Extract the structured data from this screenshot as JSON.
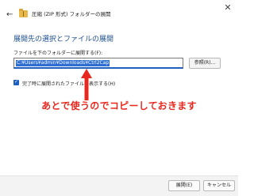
{
  "window": {
    "title": "圧縮 (ZIP 形式) フォルダーの展開",
    "close_glyph": "✕",
    "back_glyph": "←"
  },
  "main": {
    "heading": "展開先の選択とファイルの展開",
    "destination": {
      "label": "ファイルを下のフォルダーに展開する(F):",
      "value": "C:¥Users¥admin¥Downloads¥Ctrl2Cap"
    },
    "browse_label": "参照(R)...",
    "show_files_checkbox": {
      "label": "完了時に展開されたファイルを表示する(H)",
      "checked": true,
      "check_glyph": "✓"
    }
  },
  "annotation": {
    "text": "あとで使うのでコピーしておきます",
    "color": "#e8281e"
  },
  "footer": {
    "extract_label": "展開(E)",
    "cancel_label": "キャンセル"
  },
  "colors": {
    "accent": "#1e5fbf",
    "selection": "#2f6fd1",
    "heading": "#1e4f8f"
  }
}
